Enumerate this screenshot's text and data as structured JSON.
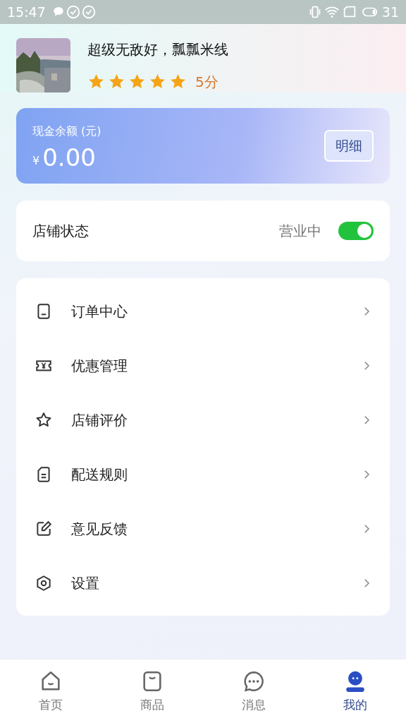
{
  "status_bar": {
    "time": "15:47",
    "battery": "31"
  },
  "shop": {
    "name": "超级无敌好，瓢瓢米线",
    "stars": 5,
    "score": "5分"
  },
  "balance": {
    "label": "现金余额 (元)",
    "currency": "¥",
    "amount": "0.00",
    "button": "明细"
  },
  "store_status": {
    "label": "店铺状态",
    "value": "营业中",
    "on": true
  },
  "menu": [
    {
      "kind": "order",
      "label": "订单中心"
    },
    {
      "kind": "coupon",
      "label": "优惠管理"
    },
    {
      "kind": "review",
      "label": "店铺评价"
    },
    {
      "kind": "rules",
      "label": "配送规则"
    },
    {
      "kind": "feedback",
      "label": "意见反馈"
    },
    {
      "kind": "settings",
      "label": "设置"
    }
  ],
  "nav": [
    {
      "kind": "home",
      "label": "首页",
      "selected": false
    },
    {
      "kind": "goods",
      "label": "商品",
      "selected": false
    },
    {
      "kind": "message",
      "label": "消息",
      "selected": false
    },
    {
      "kind": "mine",
      "label": "我的",
      "selected": true
    }
  ]
}
